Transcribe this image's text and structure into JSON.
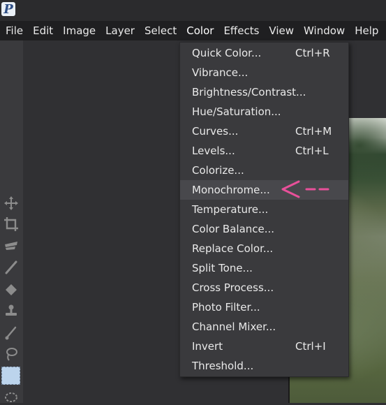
{
  "app": {
    "icon_glyph": "P",
    "icon_name": "app-logo-icon"
  },
  "menubar": {
    "items": [
      {
        "label": "File"
      },
      {
        "label": "Edit"
      },
      {
        "label": "Image"
      },
      {
        "label": "Layer"
      },
      {
        "label": "Select"
      },
      {
        "label": "Color"
      },
      {
        "label": "Effects"
      },
      {
        "label": "View"
      },
      {
        "label": "Window"
      },
      {
        "label": "Help"
      }
    ],
    "active": "Color"
  },
  "color_menu": {
    "items": [
      {
        "label": "Quick Color...",
        "shortcut": "Ctrl+R"
      },
      {
        "label": "Vibrance...",
        "shortcut": ""
      },
      {
        "label": "Brightness/Contrast...",
        "shortcut": ""
      },
      {
        "label": "Hue/Saturation...",
        "shortcut": ""
      },
      {
        "label": "Curves...",
        "shortcut": "Ctrl+M"
      },
      {
        "label": "Levels...",
        "shortcut": "Ctrl+L"
      },
      {
        "label": "Colorize...",
        "shortcut": ""
      },
      {
        "label": "Monochrome...",
        "shortcut": ""
      },
      {
        "label": "Temperature...",
        "shortcut": ""
      },
      {
        "label": "Color Balance...",
        "shortcut": ""
      },
      {
        "label": "Replace Color...",
        "shortcut": ""
      },
      {
        "label": "Split Tone...",
        "shortcut": ""
      },
      {
        "label": "Cross Process...",
        "shortcut": ""
      },
      {
        "label": "Photo Filter...",
        "shortcut": ""
      },
      {
        "label": "Channel Mixer...",
        "shortcut": ""
      },
      {
        "label": "Invert",
        "shortcut": "Ctrl+I"
      },
      {
        "label": "Threshold...",
        "shortcut": ""
      }
    ],
    "highlighted": "Monochrome..."
  },
  "toolbar": {
    "tools": [
      "move-tool-icon",
      "crop-tool-icon",
      "brush-stroke-tool-icon",
      "pencil-tool-icon",
      "eraser-tool-icon",
      "clone-stamp-tool-icon",
      "smudge-tool-icon",
      "lasso-tool-icon",
      "rect-select-tool-icon",
      "ellipse-select-tool-icon"
    ],
    "selected": "rect-select-tool-icon"
  },
  "annotation": {
    "icon": "pink-dashed-arrow-icon",
    "color": "#e8509a"
  },
  "colors": {
    "menubar_bg": "#1f1f21",
    "dropdown_bg": "#3a3a3d",
    "highlight_bg": "#48484c",
    "text": "#e9e9e9"
  }
}
